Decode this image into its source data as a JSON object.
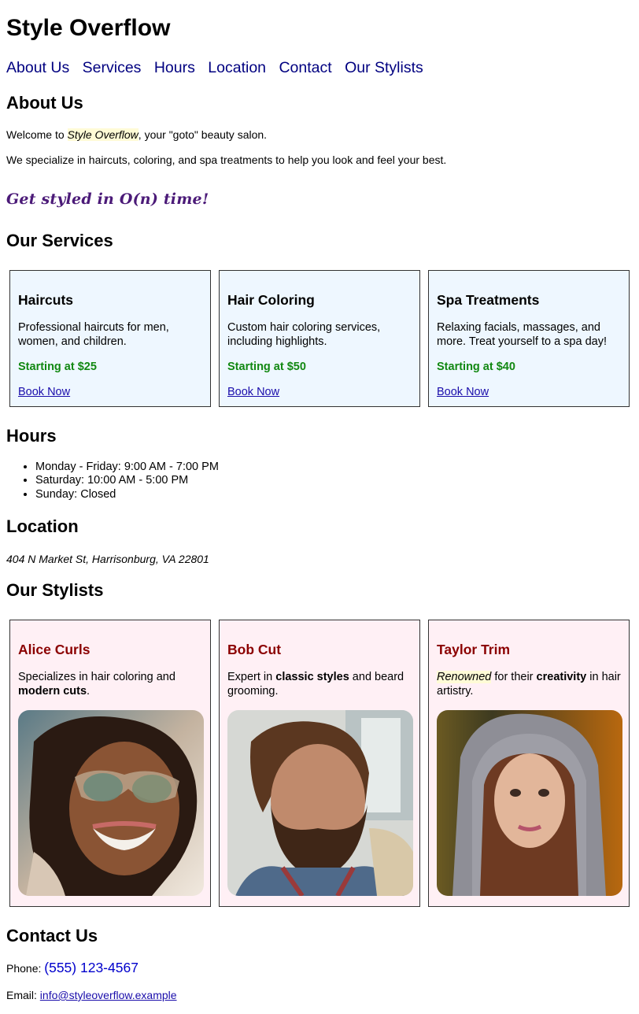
{
  "header": {
    "title": "Style Overflow"
  },
  "nav": {
    "items": [
      "About Us",
      "Services",
      "Hours",
      "Location",
      "Contact",
      "Our Stylists"
    ]
  },
  "about": {
    "title": "About Us",
    "welcome_prefix": "Welcome to ",
    "welcome_brand": "Style Overflow",
    "welcome_suffix": ", your \"goto\" beauty salon.",
    "description": "We specialize in haircuts, coloring, and spa treatments to help you look and feel your best.",
    "tagline": "Get styled in O(n) time!"
  },
  "services": {
    "title": "Our Services",
    "items": [
      {
        "name": "Haircuts",
        "description": "Professional haircuts for men, women, and children.",
        "price": "Starting at $25",
        "cta": "Book Now"
      },
      {
        "name": "Hair Coloring",
        "description": "Custom hair coloring services, including highlights.",
        "price": "Starting at $50",
        "cta": "Book Now"
      },
      {
        "name": "Spa Treatments",
        "description": "Relaxing facials, massages, and more. Treat yourself to a spa day!",
        "price": "Starting at $40",
        "cta": "Book Now"
      }
    ]
  },
  "hours": {
    "title": "Hours",
    "items": [
      "Monday - Friday: 9:00 AM - 7:00 PM",
      "Saturday: 10:00 AM - 5:00 PM",
      "Sunday: Closed"
    ]
  },
  "location": {
    "title": "Location",
    "address": "404 N Market St, Harrisonburg, VA 22801"
  },
  "stylists": {
    "title": "Our Stylists",
    "items": [
      {
        "name": "Alice Curls",
        "desc_a": "Specializes in hair coloring and ",
        "desc_b": "modern cuts",
        "desc_c": "."
      },
      {
        "name": "Bob Cut",
        "desc_a": "Expert in ",
        "desc_b": "classic styles",
        "desc_c": " and beard grooming."
      },
      {
        "name": "Taylor Trim",
        "desc_a": "Renowned",
        "desc_b": " for their ",
        "desc_c": "creativity",
        "desc_d": " in hair artistry."
      }
    ]
  },
  "contact": {
    "title": "Contact Us",
    "phone_label": "Phone: ",
    "phone": "(555) 123-4567",
    "email_label": "Email: ",
    "email": "info@styleoverflow.example"
  }
}
